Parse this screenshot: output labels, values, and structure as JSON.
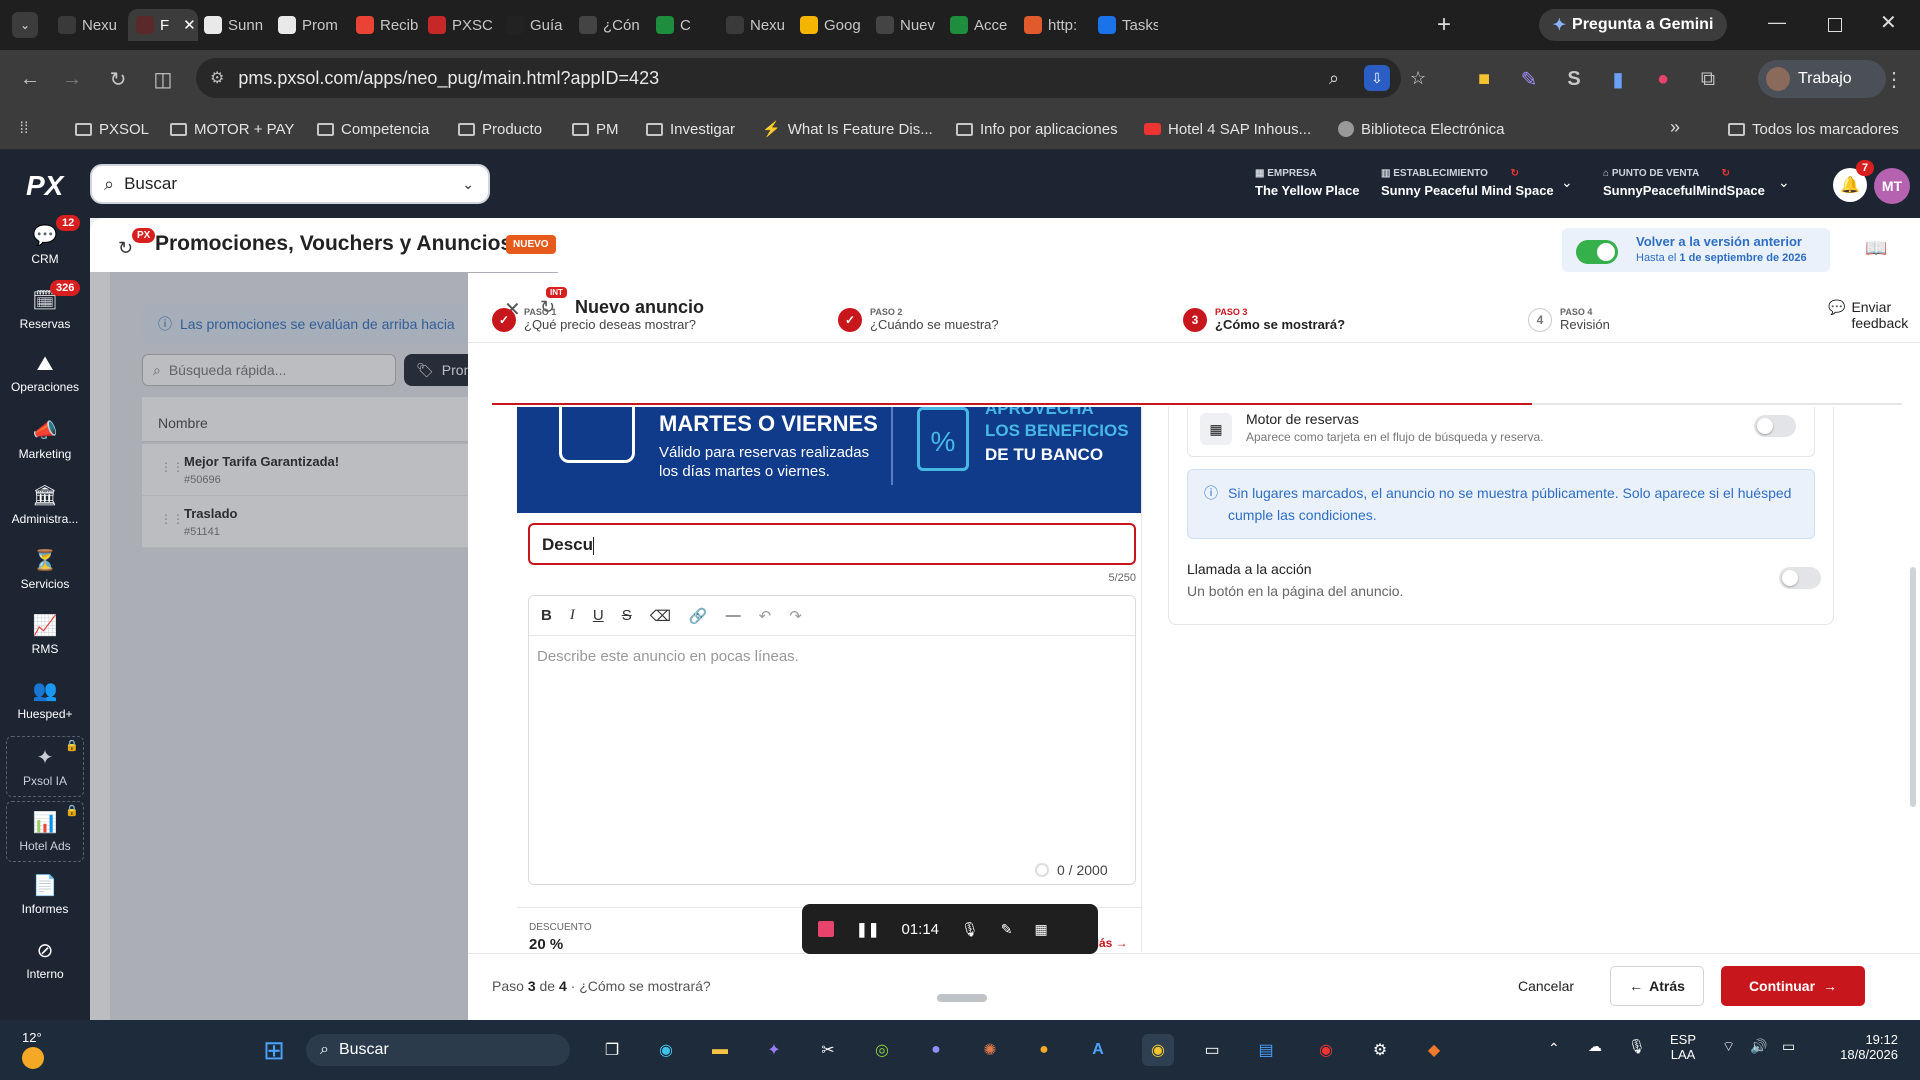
{
  "browser": {
    "tabs": [
      "Nexu",
      "F",
      "Sunn",
      "Prom",
      "Recib",
      "PXSC",
      "Guía",
      "¿Cón",
      "C",
      "Nexu",
      "Goog",
      "Nuev",
      "Acce",
      "http:",
      "Tasks"
    ],
    "gemini_label": "Pregunta a Gemini",
    "url": "pms.pxsol.com/apps/neo_pug/main.html?appID=423",
    "profile_label": "Trabajo",
    "bookmarks": [
      "PXSOL",
      "MOTOR + PAY",
      "Competencia",
      "Producto",
      "PM",
      "Investigar",
      "What Is Feature Dis...",
      "Info por aplicaciones",
      "Hotel 4 SAP Inhous...",
      "Biblioteca Electrónica"
    ],
    "all_bookmarks": "Todos los marcadores"
  },
  "topbar": {
    "logo": "PX",
    "search_placeholder": "Buscar",
    "empresa_label": "EMPRESA",
    "empresa_value": "The Yellow Place",
    "establecimiento_label": "ESTABLECIMIENTO",
    "establecimiento_value": "Sunny Peaceful Mind Space",
    "punto_label": "PUNTO DE VENTA",
    "punto_value": "SunnyPeacefulMindSpace",
    "notif_count": "7",
    "avatar": "MT"
  },
  "sidebar": [
    {
      "label": "CRM",
      "badge": "12"
    },
    {
      "label": "Reservas",
      "badge": "326"
    },
    {
      "label": "Operaciones"
    },
    {
      "label": "Marketing"
    },
    {
      "label": "Administra..."
    },
    {
      "label": "Servicios"
    },
    {
      "label": "RMS"
    },
    {
      "label": "Huesped+"
    },
    {
      "label": "Pxsol IA"
    },
    {
      "label": "Hotel Ads"
    },
    {
      "label": "Informes"
    },
    {
      "label": "Interno"
    }
  ],
  "page": {
    "title": "Promociones, Vouchers y Anuncios",
    "new_badge": "NUEVO",
    "px_badge": "PX",
    "version_link": "Volver a la versión anterior",
    "version_sub_prefix": "Hasta el",
    "version_date": "1 de septiembre de 2026",
    "info_banner": "Las promociones se evalúan de arriba hacia",
    "quick_search": "Búsqueda rápida...",
    "filter_btn": "Pron",
    "col_name": "Nombre",
    "rows": [
      {
        "name": "Mejor Tarifa Garantizada!",
        "id": "#50696"
      },
      {
        "name": "Traslado",
        "id": "#51141"
      }
    ]
  },
  "panel": {
    "int_badge": "INT",
    "title": "Nuevo anuncio",
    "feedback": "Enviar feedback",
    "steps": [
      {
        "num": "PASO 1",
        "label": "¿Qué precio deseas mostrar?"
      },
      {
        "num": "PASO 2",
        "label": "¿Cuándo se muestra?"
      },
      {
        "num": "PASO 3",
        "label": "¿Cómo se mostrará?",
        "circle": "3"
      },
      {
        "num": "PASO 4",
        "label": "Revisión",
        "circle": "4"
      }
    ],
    "banner": {
      "left_title": "MARTES O VIERNES",
      "left_sub1": "Válido para reservas realizadas",
      "left_sub2": "los días martes o viernes.",
      "right_top": "APROVECHA",
      "right_1": "LOS BENEFICIOS",
      "right_2": "DE TU BANCO"
    },
    "title_input": "Descu",
    "title_count": "5/250",
    "desc_placeholder": "Describe este anuncio en pocas líneas.",
    "desc_count": "0 / 2000",
    "descuento_label": "DESCUENTO",
    "descuento_value": "20 %",
    "mas_link": "Más",
    "motor_title": "Motor de reservas",
    "motor_sub": "Aparece como tarjeta en el flujo de búsqueda y reserva.",
    "info_text": "Sin lugares marcados, el anuncio no se muestra públicamente. Solo aparece si el huésped cumple las condiciones.",
    "cta_title": "Llamada a la acción",
    "cta_sub": "Un botón en la página del anuncio.",
    "footer_paso": "Paso",
    "footer_cur": "3",
    "footer_de": "de",
    "footer_total": "4",
    "footer_label": "· ¿Cómo se mostrará?",
    "cancel": "Cancelar",
    "back": "Atrás",
    "continue": "Continuar"
  },
  "recorder": {
    "time": "01:14"
  },
  "taskbar": {
    "temp": "12°",
    "search": "Buscar",
    "lang1": "ESP",
    "lang2": "LAA",
    "time": "19:12",
    "date": "18/8/2026"
  }
}
